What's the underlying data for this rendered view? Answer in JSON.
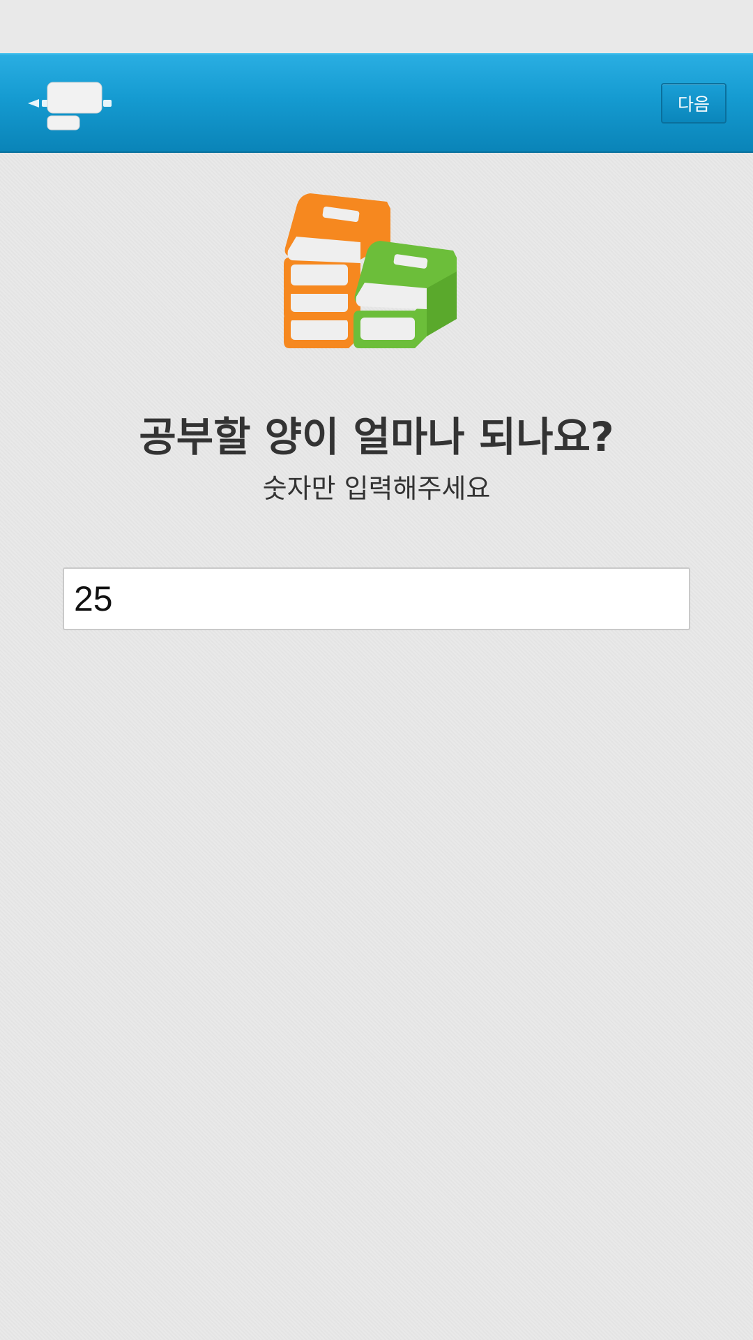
{
  "header": {
    "app_icon": "projector-presentation-icon",
    "next_label": "다음",
    "bar_color": "#1596cc"
  },
  "main": {
    "illustration": "stacked-books-icon",
    "question": "공부할 양이 얼마나 되나요?",
    "hint": "숫자만 입력해주세요",
    "amount_input": {
      "value": "25",
      "placeholder": ""
    }
  },
  "colors": {
    "book_orange": "#f6881f",
    "book_green": "#6cbe3a",
    "text": "#333333",
    "background": "#e8e8e8"
  }
}
